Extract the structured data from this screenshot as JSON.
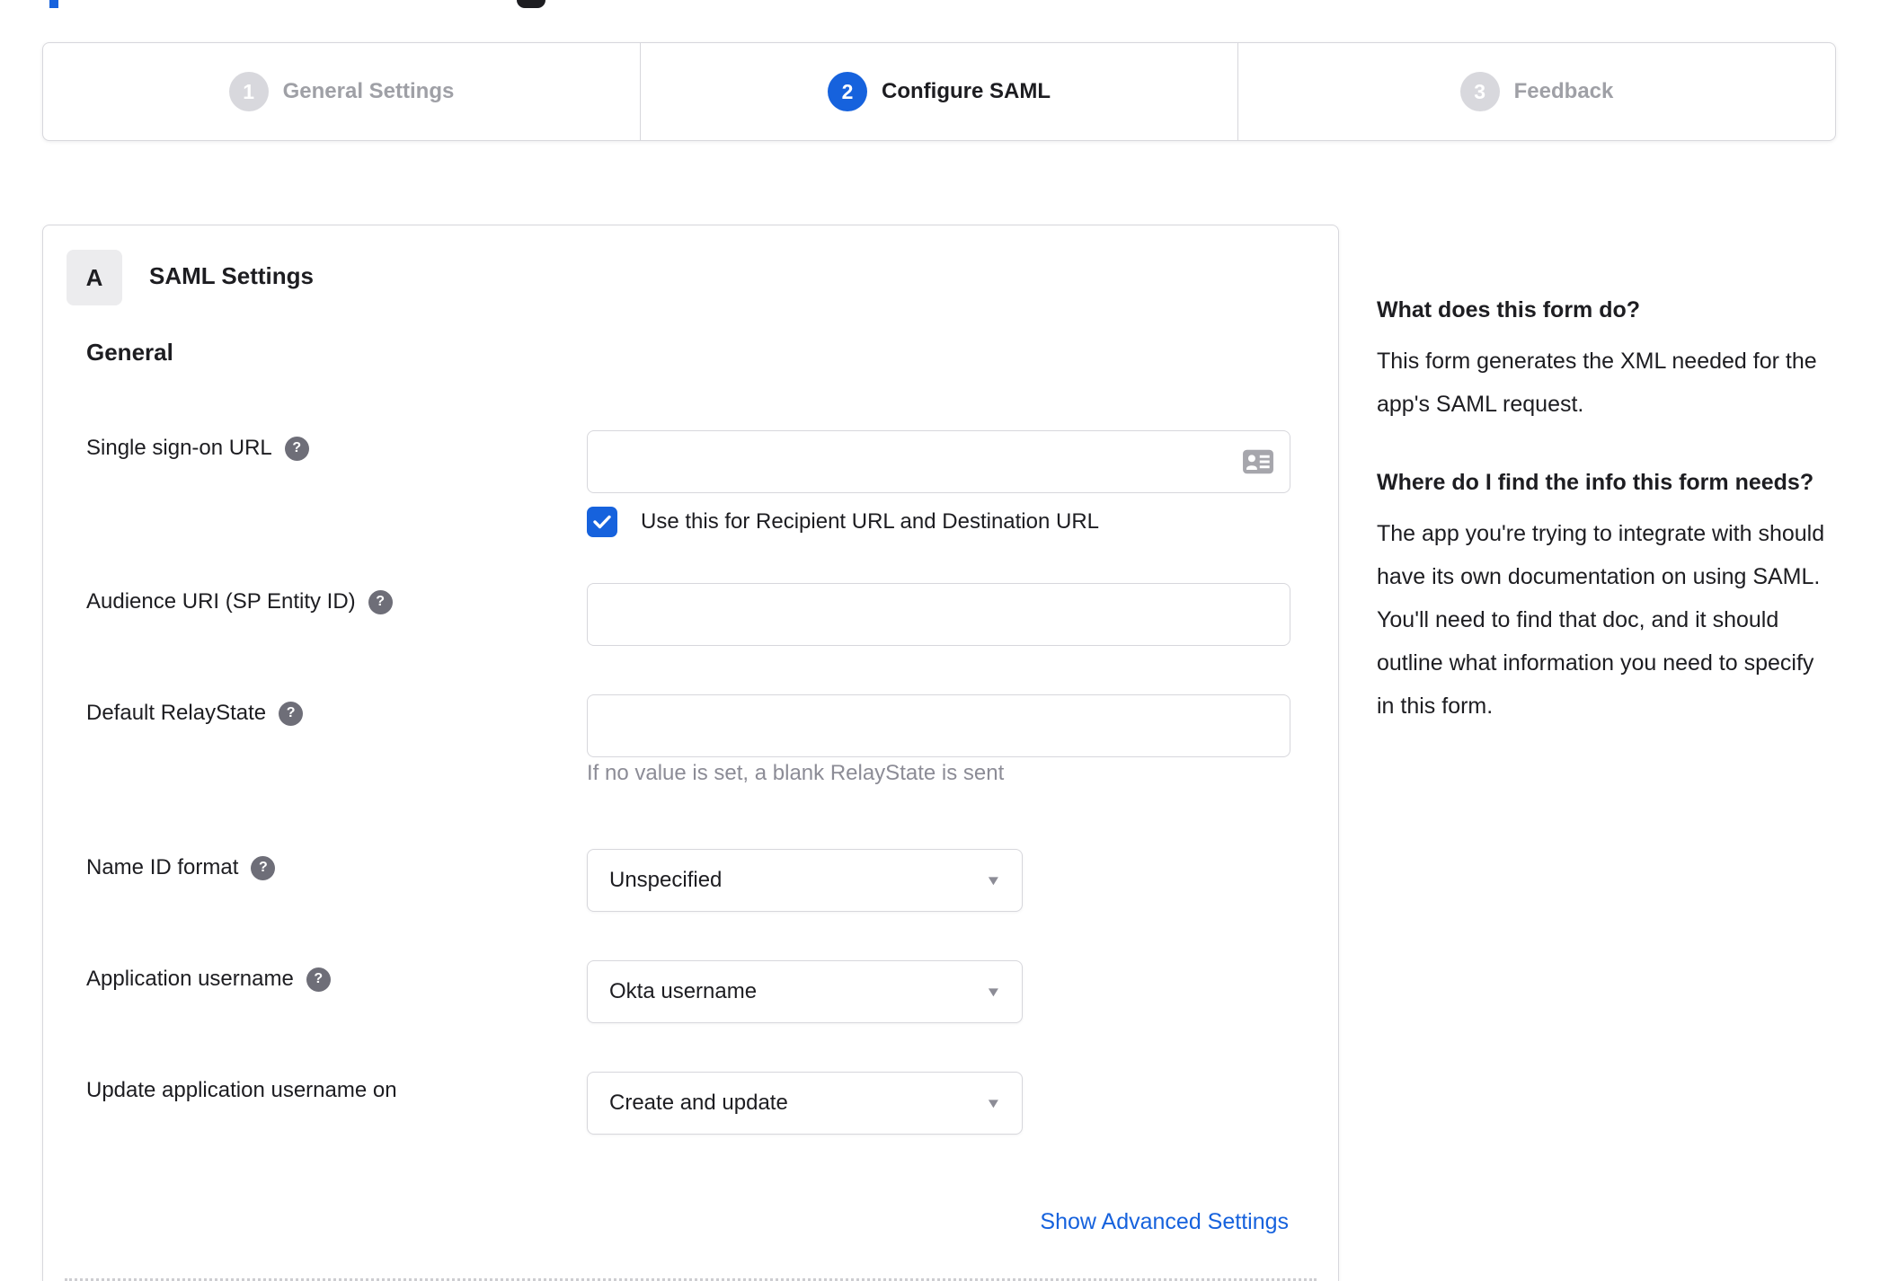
{
  "stepper": {
    "steps": [
      {
        "number": "1",
        "label": "General Settings",
        "state": "inactive"
      },
      {
        "number": "2",
        "label": "Configure SAML",
        "state": "active"
      },
      {
        "number": "3",
        "label": "Feedback",
        "state": "inactive"
      }
    ]
  },
  "panel": {
    "section_badge": "A",
    "section_title": "SAML Settings",
    "subsection_title": "General",
    "fields": {
      "sso_url": {
        "label": "Single sign-on URL",
        "value": "",
        "checkbox": {
          "checked": true,
          "label": "Use this for Recipient URL and Destination URL"
        }
      },
      "audience_uri": {
        "label": "Audience URI (SP Entity ID)",
        "value": ""
      },
      "relay_state": {
        "label": "Default RelayState",
        "value": "",
        "hint": "If no value is set, a blank RelayState is sent"
      },
      "name_id_format": {
        "label": "Name ID format",
        "value": "Unspecified"
      },
      "application_username": {
        "label": "Application username",
        "value": "Okta username"
      },
      "update_application_username_on": {
        "label": "Update application username on",
        "value": "Create and update"
      }
    },
    "advanced_link": "Show Advanced Settings"
  },
  "sidebar": {
    "blocks": [
      {
        "heading": "What does this form do?",
        "body": "This form generates the XML needed for the app's SAML request."
      },
      {
        "heading": "Where do I find the info this form needs?",
        "body": "The app you're trying to integrate with should have its own documentation on using SAML. You'll need to find that doc, and it should outline what information you need to specify in this form."
      }
    ]
  },
  "icons": {
    "help": "?",
    "caret": "▼"
  },
  "colors": {
    "accent_blue": "#1662dd",
    "text_dark": "#1d1d21",
    "muted_gray": "#8c8c96",
    "border_gray": "#d7d7dc",
    "step_inactive_gray": "#d8d8dd"
  }
}
